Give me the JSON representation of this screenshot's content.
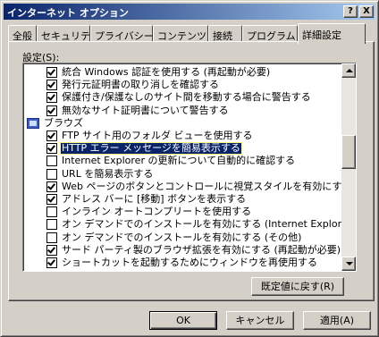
{
  "window": {
    "title": "インターネット オプション",
    "help_glyph": "?",
    "close_glyph": "X"
  },
  "tabs": [
    {
      "label": "全般"
    },
    {
      "label": "セキュリティ"
    },
    {
      "label": "プライバシー"
    },
    {
      "label": "コンテンツ"
    },
    {
      "label": "接続"
    },
    {
      "label": "プログラム"
    },
    {
      "label": "詳細設定",
      "active": true
    }
  ],
  "settings_label": "設定(S):",
  "items": [
    {
      "type": "checkbox",
      "checked": true,
      "label": "統合 Windows 認証を使用する (再起動が必要)"
    },
    {
      "type": "checkbox",
      "checked": true,
      "label": "発行元証明書の取り消しを確認する"
    },
    {
      "type": "checkbox",
      "checked": true,
      "label": "保護付き/保護なしのサイト間を移動する場合に警告する"
    },
    {
      "type": "checkbox",
      "checked": true,
      "label": "無効なサイト証明書について警告する"
    },
    {
      "type": "category",
      "label": "ブラウズ",
      "icon": "browse-category-icon"
    },
    {
      "type": "checkbox",
      "checked": true,
      "label": "FTP サイト用のフォルダ ビューを使用する"
    },
    {
      "type": "checkbox",
      "checked": true,
      "label": "HTTP エラー メッセージを簡易表示する",
      "selected": true
    },
    {
      "type": "checkbox",
      "checked": false,
      "label": "Internet Explorer の更新について自動的に確認する"
    },
    {
      "type": "checkbox",
      "checked": false,
      "label": "URL を簡易表示する"
    },
    {
      "type": "checkbox",
      "checked": true,
      "label": "Web ページのボタンとコントロールに視覚スタイルを有効にする"
    },
    {
      "type": "checkbox",
      "checked": true,
      "label": "アドレス バーに [移動] ボタンを表示する"
    },
    {
      "type": "checkbox",
      "checked": false,
      "label": "インライン オートコンプリートを使用する"
    },
    {
      "type": "checkbox",
      "checked": false,
      "label": "オン デマンドでのインストールを有効にする (Internet Explorer)"
    },
    {
      "type": "checkbox",
      "checked": false,
      "label": "オン デマンドでのインストールを有効にする (その他)"
    },
    {
      "type": "checkbox",
      "checked": true,
      "label": "サード パーティ製のブラウザ拡張を有効にする (再起動が必要)"
    },
    {
      "type": "checkbox",
      "checked": true,
      "label": "ショートカットを起動するためにウィンドウを再使用する"
    }
  ],
  "buttons": {
    "restore_defaults": "既定値に戻す(R)",
    "ok": "OK",
    "cancel": "キャンセル",
    "apply": "適用(A)"
  }
}
